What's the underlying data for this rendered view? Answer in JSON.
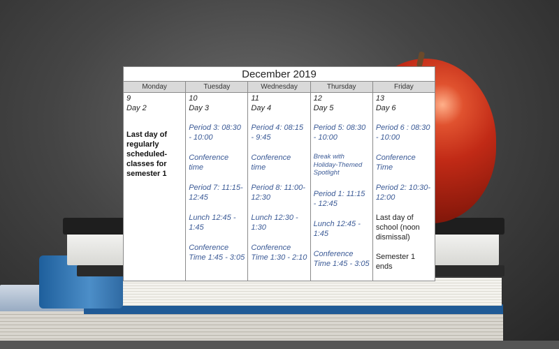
{
  "calendar": {
    "title": "December 2019",
    "days": [
      {
        "weekday": "Monday",
        "date": "9",
        "day": "Day 2",
        "events": [],
        "note_bold": "Last day of regularly scheduled-classes for semester 1"
      },
      {
        "weekday": "Tuesday",
        "date": "10",
        "day": "Day 3",
        "events": [
          "Period 3: 08:30 - 10:00",
          "Conference time",
          "Period 7: 11:15-12:45",
          "Lunch 12:45 - 1:45",
          "Conference Time 1:45 - 3:05"
        ]
      },
      {
        "weekday": "Wednesday",
        "date": "11",
        "day": "Day 4",
        "events": [
          "Period 4: 08:15 - 9:45",
          "Conference time",
          "Period 8: 11:00-12:30",
          "Lunch 12:30 - 1:30",
          "Conference Time 1:30 - 2:10"
        ]
      },
      {
        "weekday": "Thursday",
        "date": "12",
        "day": "Day 5",
        "events": [
          "Period 5: 08:30 - 10:00",
          "Break with Holiday-Themed Spotlight",
          "Period 1: 11:15 - 12:45",
          "Lunch 12:45 - 1:45",
          "Conference Time 1:45 - 3:05"
        ]
      },
      {
        "weekday": "Friday",
        "date": "13",
        "day": "Day 6",
        "events": [
          "Period 6 : 08:30 - 10:00",
          "Conference Time",
          "Period 2: 10:30-12:00"
        ],
        "notes": [
          "Last day of school (noon dismissal)",
          "Semester 1 ends"
        ]
      }
    ]
  }
}
